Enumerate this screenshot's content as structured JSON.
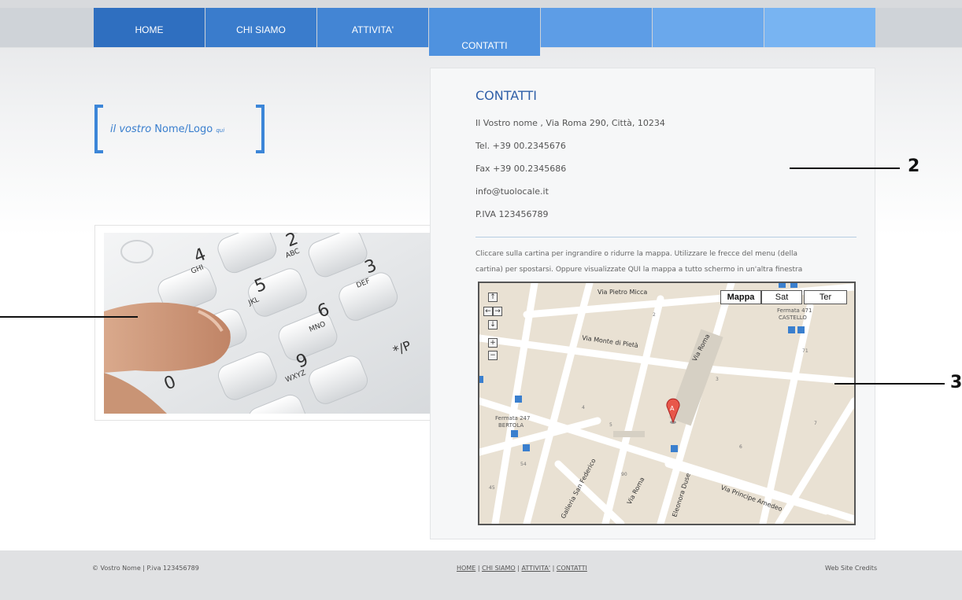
{
  "nav": {
    "items": [
      {
        "label": "HOME",
        "color": "#2f6fc0"
      },
      {
        "label": "CHI SIAMO",
        "color": "#3a7ccc"
      },
      {
        "label": "ATTIVITA'",
        "color": "#4385d4"
      },
      {
        "label": "CONTATTI",
        "color": "#4f92df"
      },
      {
        "label": "",
        "color": "#5d9de6"
      },
      {
        "label": "",
        "color": "#6aa8ec"
      },
      {
        "label": "",
        "color": "#78b4f2"
      }
    ],
    "active": "CONTATTI"
  },
  "logo": {
    "part1": "il vostro",
    "part2": " Nome/Logo ",
    "part3": "qui"
  },
  "contact": {
    "title": "CONTATTI",
    "address": "Il Vostro nome , Via Roma 290, Città, 10234",
    "tel": "Tel. +39 00.2345676",
    "fax": "Fax +39 00.2345686",
    "email": "info@tuolocale.it",
    "piva": "P.IVA 123456789",
    "note_line1": "Cliccare sulla cartina per ingrandire o ridurre la mappa. Utilizzare le frecce del menu (della",
    "note_line2": "cartina) per spostarsi. Oppure visualizzate QUI la mappa a tutto schermo in un'altra finestra"
  },
  "photo": {
    "keys": [
      {
        "num": "4",
        "letters": "GHI"
      },
      {
        "num": "2",
        "letters": "ABC"
      },
      {
        "num": "3",
        "letters": "DEF"
      },
      {
        "num": "5",
        "letters": "JKL"
      },
      {
        "num": "6",
        "letters": "MNO"
      },
      {
        "num": "9",
        "letters": "WXYZ"
      },
      {
        "num": "0",
        "letters": ""
      },
      {
        "num": "*/P",
        "letters": ""
      }
    ]
  },
  "map": {
    "buttons": [
      "Mappa",
      "Sat",
      "Ter"
    ],
    "selected": "Mappa",
    "controls": [
      "↑",
      "←",
      "→",
      "↓",
      "+",
      "−"
    ],
    "marker": "A",
    "streets": [
      "Via Pietro Micca",
      "Via Monte di Pietà",
      "Via Roma",
      "Via Roma",
      "Galleria San Federico",
      "Eleonora Duse",
      "Via Principe Amedeo"
    ],
    "stops": [
      "Fermata 471",
      "CASTELLO",
      "Fermata 247",
      "BERTOLA"
    ],
    "numbers": [
      "2",
      "3",
      "4",
      "5",
      "6",
      "7",
      "71",
      "54",
      "90",
      "45"
    ]
  },
  "annotations": {
    "two": "2",
    "three": "3"
  },
  "footer": {
    "left": "© Vostro Nome | P.iva 123456789",
    "links": [
      "HOME",
      "CHI SIAMO",
      "ATTIVITA'",
      "CONTATTI"
    ],
    "separator": " | ",
    "right": "Web Site Credits"
  }
}
